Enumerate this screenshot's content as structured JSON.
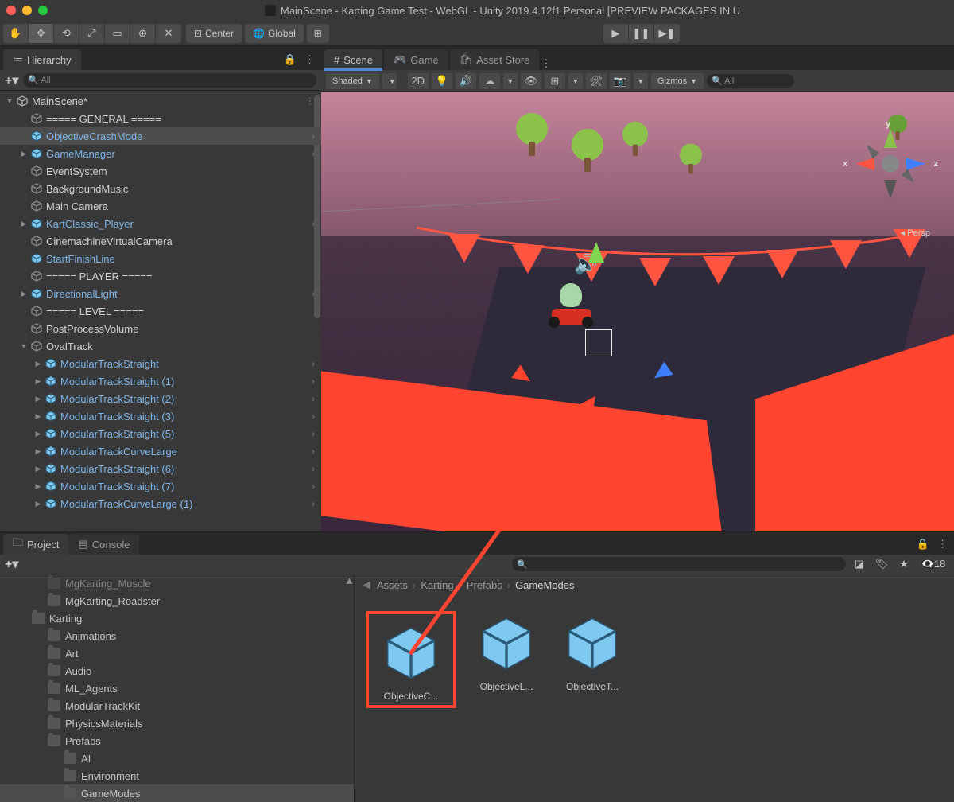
{
  "titlebar": {
    "title": "MainScene - Karting Game Test - WebGL - Unity 2019.4.12f1 Personal [PREVIEW PACKAGES IN U"
  },
  "toolbar": {
    "center": "Center",
    "global": "Global"
  },
  "hierarchy": {
    "tab": "Hierarchy",
    "search_placeholder": "All",
    "scene": "MainScene*",
    "items": [
      {
        "label": "===== GENERAL =====",
        "blue": false,
        "indent": 1,
        "expand": "none"
      },
      {
        "label": "ObjectiveCrashMode",
        "blue": true,
        "indent": 1,
        "expand": "none",
        "selected": true,
        "chev": true
      },
      {
        "label": "GameManager",
        "blue": true,
        "indent": 1,
        "expand": "closed",
        "chev": true
      },
      {
        "label": "EventSystem",
        "blue": false,
        "indent": 1,
        "expand": "none"
      },
      {
        "label": "BackgroundMusic",
        "blue": false,
        "indent": 1,
        "expand": "none"
      },
      {
        "label": "Main Camera",
        "blue": false,
        "indent": 1,
        "expand": "none",
        "icon": "camera"
      },
      {
        "label": "KartClassic_Player",
        "blue": true,
        "indent": 1,
        "expand": "closed",
        "chev": true
      },
      {
        "label": "CinemachineVirtualCamera",
        "blue": false,
        "indent": 1,
        "expand": "none"
      },
      {
        "label": "StartFinishLine",
        "blue": true,
        "indent": 1,
        "expand": "none"
      },
      {
        "label": "===== PLAYER =====",
        "blue": false,
        "indent": 1,
        "expand": "none"
      },
      {
        "label": "DirectionalLight",
        "blue": true,
        "indent": 1,
        "expand": "closed",
        "chev": true
      },
      {
        "label": "===== LEVEL =====",
        "blue": false,
        "indent": 1,
        "expand": "none"
      },
      {
        "label": "PostProcessVolume",
        "blue": false,
        "indent": 1,
        "expand": "none"
      },
      {
        "label": "OvalTrack",
        "blue": false,
        "indent": 1,
        "expand": "open"
      },
      {
        "label": "ModularTrackStraight",
        "blue": true,
        "indent": 2,
        "expand": "closed",
        "chev": true
      },
      {
        "label": "ModularTrackStraight (1)",
        "blue": true,
        "indent": 2,
        "expand": "closed",
        "chev": true
      },
      {
        "label": "ModularTrackStraight (2)",
        "blue": true,
        "indent": 2,
        "expand": "closed",
        "chev": true
      },
      {
        "label": "ModularTrackStraight (3)",
        "blue": true,
        "indent": 2,
        "expand": "closed",
        "chev": true
      },
      {
        "label": "ModularTrackStraight (5)",
        "blue": true,
        "indent": 2,
        "expand": "closed",
        "chev": true
      },
      {
        "label": "ModularTrackCurveLarge",
        "blue": true,
        "indent": 2,
        "expand": "closed",
        "chev": true
      },
      {
        "label": "ModularTrackStraight (6)",
        "blue": true,
        "indent": 2,
        "expand": "closed",
        "chev": true
      },
      {
        "label": "ModularTrackStraight (7)",
        "blue": true,
        "indent": 2,
        "expand": "closed",
        "chev": true
      },
      {
        "label": "ModularTrackCurveLarge (1)",
        "blue": true,
        "indent": 2,
        "expand": "closed",
        "chev": true
      }
    ]
  },
  "scene": {
    "tab_scene": "Scene",
    "tab_game": "Game",
    "tab_store": "Asset Store",
    "shaded": "Shaded",
    "twod": "2D",
    "gizmos": "Gizmos",
    "search_placeholder": "All",
    "persp": "Persp",
    "axis_x": "x",
    "axis_y": "y",
    "axis_z": "z"
  },
  "project": {
    "tab_project": "Project",
    "tab_console": "Console",
    "hidden_count": "18",
    "search_placeholder": "",
    "folders": [
      {
        "label": "MgKarting_Muscle",
        "indent": 2,
        "cut": true
      },
      {
        "label": "MgKarting_Roadster",
        "indent": 2
      },
      {
        "label": "Karting",
        "indent": 1,
        "expand": "open"
      },
      {
        "label": "Animations",
        "indent": 2,
        "expand": "closed"
      },
      {
        "label": "Art",
        "indent": 2,
        "expand": "closed"
      },
      {
        "label": "Audio",
        "indent": 2,
        "expand": "closed"
      },
      {
        "label": "ML_Agents",
        "indent": 2,
        "expand": "closed"
      },
      {
        "label": "ModularTrackKit",
        "indent": 2,
        "expand": "closed"
      },
      {
        "label": "PhysicsMaterials",
        "indent": 2
      },
      {
        "label": "Prefabs",
        "indent": 2,
        "expand": "open"
      },
      {
        "label": "AI",
        "indent": 3
      },
      {
        "label": "Environment",
        "indent": 3
      },
      {
        "label": "GameModes",
        "indent": 3,
        "selected": true
      }
    ],
    "breadcrumb": [
      "Assets",
      "Karting",
      "Prefabs",
      "GameModes"
    ],
    "assets": [
      {
        "label": "ObjectiveC...",
        "highlighted": true
      },
      {
        "label": "ObjectiveL..."
      },
      {
        "label": "ObjectiveT..."
      }
    ]
  }
}
